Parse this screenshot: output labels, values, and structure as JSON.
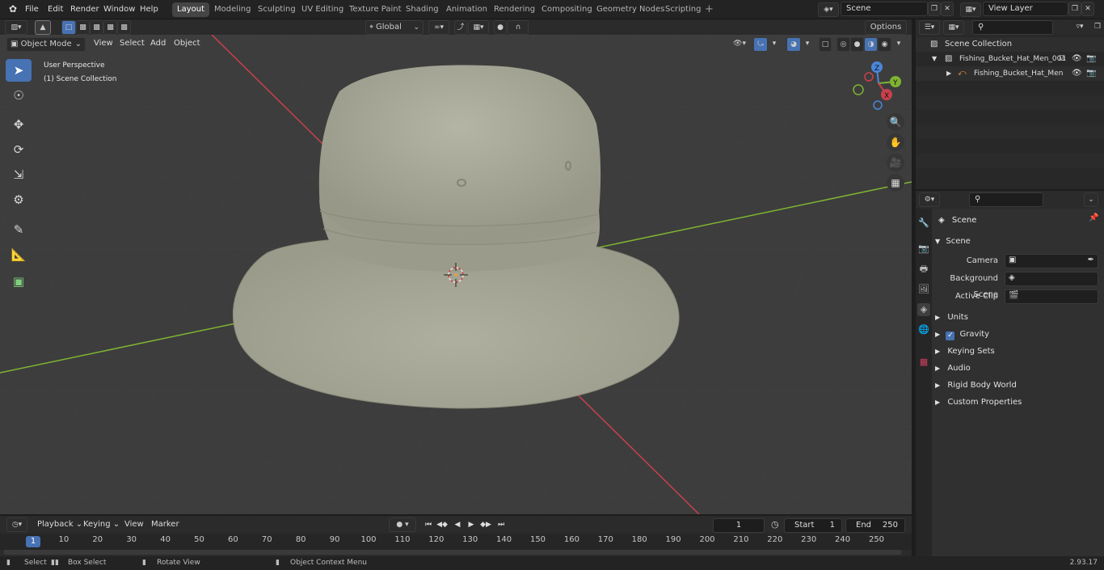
{
  "topbar": {
    "menus": [
      "File",
      "Edit",
      "Render",
      "Window",
      "Help"
    ],
    "workspaces": [
      "Layout",
      "Modeling",
      "Sculpting",
      "UV Editing",
      "Texture Paint",
      "Shading",
      "Animation",
      "Rendering",
      "Compositing",
      "Geometry Nodes",
      "Scripting"
    ],
    "active_workspace": "Layout",
    "scene_name": "Scene",
    "view_layer": "View Layer"
  },
  "vp_header": {
    "transform_orientation": "Global",
    "options_label": "Options",
    "mode": "Object Mode",
    "menus": [
      "View",
      "Select",
      "Add",
      "Object"
    ]
  },
  "viewport": {
    "perspective": "User Perspective",
    "collection": "(1) Scene Collection",
    "gizmo_axes": [
      "Z",
      "Y",
      "X"
    ]
  },
  "outliner": {
    "root": "Scene Collection",
    "collection": "Fishing_Bucket_Hat_Men_001",
    "object": "Fishing_Bucket_Hat_Men"
  },
  "properties": {
    "context": "Scene",
    "section": "Scene",
    "fields": [
      {
        "label": "Camera"
      },
      {
        "label": "Background Scene"
      },
      {
        "label": "Active Clip"
      }
    ],
    "panels": [
      "Units",
      "Gravity",
      "Keying Sets",
      "Audio",
      "Rigid Body World",
      "Custom Properties"
    ],
    "gravity_checked": true
  },
  "timeline": {
    "menus": [
      "Playback",
      "Keying",
      "View",
      "Marker"
    ],
    "current_frame": "1",
    "start_label": "Start",
    "start_value": "1",
    "end_label": "End",
    "end_value": "250",
    "ruler": [
      "1",
      "10",
      "20",
      "30",
      "40",
      "50",
      "60",
      "70",
      "80",
      "90",
      "100",
      "110",
      "120",
      "130",
      "140",
      "150",
      "160",
      "170",
      "180",
      "190",
      "200",
      "210",
      "220",
      "230",
      "240",
      "250"
    ]
  },
  "statusbar": {
    "select": "Select",
    "box_select": "Box Select",
    "rotate": "Rotate View",
    "context_menu": "Object Context Menu",
    "version": "2.93.17"
  },
  "colors": {
    "accent": "#4772b3",
    "x_axis": "#c8414c",
    "y_axis": "#7fb432",
    "hat": "#a7a896"
  }
}
